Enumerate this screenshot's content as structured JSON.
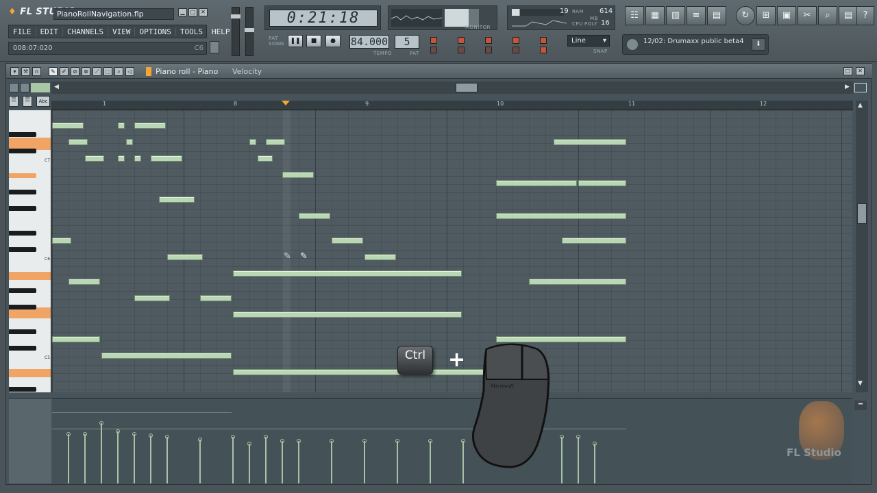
{
  "app": {
    "logo": "FL STUDIO",
    "filename": "PianoRollNavigation.flp",
    "hint_time": "008:07:020",
    "hint_note": "C6",
    "watermark": "FL Studio"
  },
  "menu": [
    "FILE",
    "EDIT",
    "CHANNELS",
    "VIEW",
    "OPTIONS",
    "TOOLS",
    "HELP"
  ],
  "transport": {
    "time": "0:21:18",
    "pat": "PAT",
    "song": "SONG",
    "tempo": "84.000",
    "tempo_label": "TEMPO",
    "pattern": "5",
    "pattern_label": "PAT"
  },
  "monitor": {
    "label": "MONITOR",
    "cpu_label": "CPU",
    "ram_label": "RAM",
    "poly_label": "POLY",
    "mb_label": "MB",
    "cpu_value": "19",
    "ram_value": "614",
    "poly_value": "16"
  },
  "snap": {
    "value": "Line",
    "label": "SNAP"
  },
  "browser_hint": "12/02: Drumaxx public beta4",
  "pianoroll": {
    "title": "Piano roll - Piano",
    "target": "Velocity",
    "bars": [
      "1",
      "8",
      "9",
      "10",
      "11",
      "12"
    ],
    "key_labels": [
      "C7",
      "C6",
      "C5"
    ]
  },
  "overlay": {
    "ctrl_label": "Ctrl",
    "plus": "+",
    "mouse_brand": "Microsoft"
  }
}
